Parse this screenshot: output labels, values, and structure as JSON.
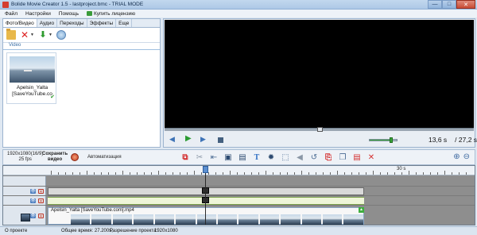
{
  "window": {
    "title": "Bolide Movie Creator 1.5 - lastproject.bmc - TRIAL MODE",
    "controls": [
      "—",
      "□",
      "✕"
    ]
  },
  "menu": {
    "items": [
      "Файл",
      "Настройки",
      "Помощь"
    ],
    "license": "Купить лицензию"
  },
  "left_panel": {
    "tabs": [
      "Фото/Видео",
      "Аудио",
      "Переходы",
      "Эффекты",
      "Еще"
    ],
    "active_tab": "Фото/Видео",
    "toolbar_icons": [
      "folder-open-icon",
      "delete-icon",
      "download-icon",
      "record-icon"
    ],
    "group_label": "Video",
    "media_items": [
      {
        "caption_line1": "Apelsin_Yalta",
        "caption_line2": "[SaveYouTube.co",
        "checked": true
      }
    ]
  },
  "preview": {
    "controls": [
      "rewind-icon",
      "play-icon",
      "forward-icon",
      "stop-icon"
    ],
    "current_time": "13,6 s",
    "duration": "/ 27,2 s",
    "seek_fraction": 0.5,
    "volume_fraction": 0.8
  },
  "timeline_toolbar": {
    "resolution_line1": "1920x1080(16/9)",
    "resolution_line2": "25 fps",
    "save_video_line1": "Сохранить",
    "save_video_line2": "видео",
    "automation": "Автоматизация",
    "tools": [
      "split-icon",
      "scissors-icon",
      "arrow-left-icon",
      "crop-icon",
      "filmstrip-icon",
      "text-icon",
      "brightness-icon",
      "transform-icon",
      "volume-icon",
      "undo-icon",
      "redo-icon",
      "copy-icon",
      "paste-icon",
      "delete-icon"
    ],
    "zoom": [
      "zoom-in-icon",
      "zoom-out-icon"
    ]
  },
  "timeline": {
    "ruler_label": "30 s",
    "clip_name": "Apelsin_Yalta [SaveYouTube.com].mp4",
    "track_buttons": [
      "👁",
      "✕"
    ],
    "playhead_label": "13,6",
    "frame_count": 14
  },
  "status": {
    "project": "О проекте",
    "total_time": "Общее время: 27.200s,",
    "resolution": "Разрешение проекта:",
    "resolution_value": "1920x1080"
  },
  "colors": {
    "accent": "#3e73b6",
    "play": "#2b9b32",
    "danger": "#d22"
  }
}
